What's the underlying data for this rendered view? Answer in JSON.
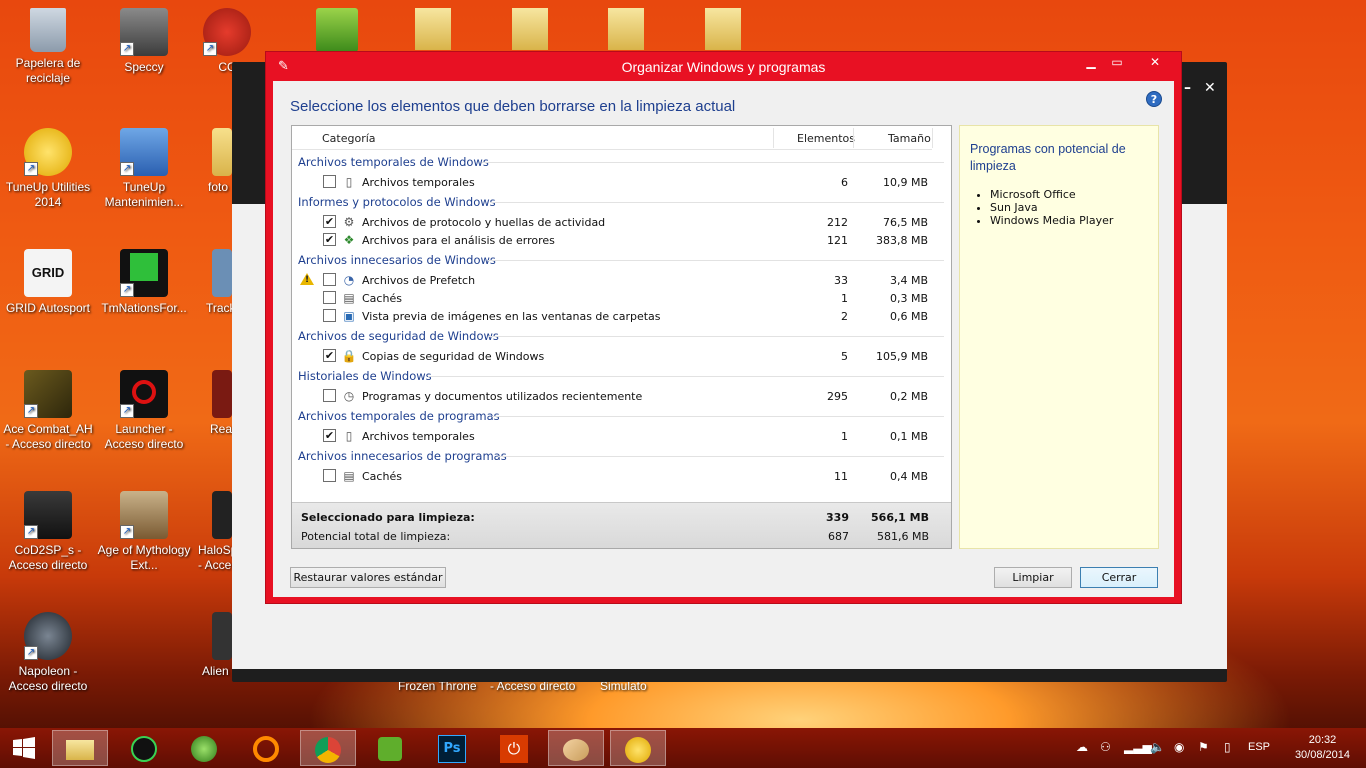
{
  "desktop": {
    "icons": [
      {
        "label": "Papelera de reciclaje",
        "icon": "recycle-bin-icon"
      },
      {
        "label": "Speccy",
        "icon": "speccy-icon"
      },
      {
        "label": "CC",
        "icon": "ccleaner-icon"
      },
      {
        "label": "TuneUp Utilities 2014",
        "icon": "tuneup-icon"
      },
      {
        "label": "TuneUp Mantenimien...",
        "icon": "tuneup-maintenance-icon"
      },
      {
        "label": "foto",
        "icon": "folder-icon"
      },
      {
        "label": "GRID Autosport",
        "icon": "grid-game-icon"
      },
      {
        "label": "TmNationsFor...",
        "icon": "tmnations-icon"
      },
      {
        "label": "Track",
        "icon": "track-icon"
      },
      {
        "label": "Ace Combat_AH - Acceso directo",
        "icon": "ace-combat-icon"
      },
      {
        "label": "Launcher - Acceso directo",
        "icon": "launcher-icon"
      },
      {
        "label": "Rea",
        "icon": "rea-icon"
      },
      {
        "label": "CoD2SP_s - Acceso directo",
        "icon": "cod2-icon"
      },
      {
        "label": "Age of Mythology Ext...",
        "icon": "age-of-mythology-icon"
      },
      {
        "label": "HaloSp - Acce",
        "icon": "halo-icon"
      },
      {
        "label": "Napoleon - Acceso directo",
        "icon": "napoleon-icon"
      },
      {
        "label": "Alien",
        "icon": "alien-icon"
      }
    ],
    "bottom_labels": [
      "Frozen Throne",
      "- Acceso directo",
      "Simulato"
    ]
  },
  "dialog": {
    "title": "Organizar Windows y programas",
    "heading": "Seleccione los elementos que deben borrarse en la limpieza actual",
    "columns": {
      "category": "Categoría",
      "items": "Elementos",
      "size": "Tamaño"
    },
    "groups": [
      {
        "name": "Archivos temporales de Windows",
        "rows": [
          {
            "label": "Archivos temporales",
            "checked": false,
            "count": "6",
            "size": "10,9 MB",
            "icon": "file-icon",
            "warning": false
          }
        ]
      },
      {
        "name": "Informes y protocolos de Windows",
        "rows": [
          {
            "label": "Archivos de protocolo y huellas de actividad",
            "checked": true,
            "count": "212",
            "size": "76,5 MB",
            "icon": "gear-file-icon",
            "warning": false
          },
          {
            "label": "Archivos para el análisis de errores",
            "checked": true,
            "count": "121",
            "size": "383,8 MB",
            "icon": "error-report-icon",
            "warning": false
          }
        ]
      },
      {
        "name": "Archivos innecesarios de Windows",
        "rows": [
          {
            "label": "Archivos de Prefetch",
            "checked": false,
            "count": "33",
            "size": "3,4 MB",
            "icon": "speedometer-icon",
            "warning": true
          },
          {
            "label": "Cachés",
            "checked": false,
            "count": "1",
            "size": "0,3 MB",
            "icon": "cache-icon",
            "warning": false
          },
          {
            "label": "Vista previa de imágenes en las ventanas de carpetas",
            "checked": false,
            "count": "2",
            "size": "0,6 MB",
            "icon": "thumbnail-icon",
            "warning": false
          }
        ]
      },
      {
        "name": "Archivos de seguridad de Windows",
        "rows": [
          {
            "label": "Copias de seguridad de Windows",
            "checked": true,
            "count": "5",
            "size": "105,9 MB",
            "icon": "backup-lock-icon",
            "warning": false
          }
        ]
      },
      {
        "name": "Historiales de Windows",
        "rows": [
          {
            "label": "Programas y documentos utilizados recientemente",
            "checked": false,
            "count": "295",
            "size": "0,2 MB",
            "icon": "history-clock-icon",
            "warning": false
          }
        ]
      },
      {
        "name": "Archivos temporales de programas",
        "rows": [
          {
            "label": "Archivos temporales",
            "checked": true,
            "count": "1",
            "size": "0,1 MB",
            "icon": "file-icon",
            "warning": false
          }
        ]
      },
      {
        "name": "Archivos innecesarios de programas",
        "rows": [
          {
            "label": "Cachés",
            "checked": false,
            "count": "11",
            "size": "0,4 MB",
            "icon": "cache-icon",
            "warning": false
          }
        ]
      }
    ],
    "summary": {
      "selected_label": "Seleccionado para limpieza:",
      "selected_count": "339",
      "selected_size": "566,1 MB",
      "potential_label": "Potencial total de limpieza:",
      "potential_count": "687",
      "potential_size": "581,6 MB"
    },
    "side_panel": {
      "title": "Programas con potencial de limpieza",
      "items": [
        "Microsoft Office",
        "Sun Java",
        "Windows Media Player"
      ]
    },
    "buttons": {
      "restore": "Restaurar valores estándar",
      "clean": "Limpiar",
      "close": "Cerrar"
    }
  },
  "taskbar": {
    "apps": [
      "windows-start-icon",
      "file-explorer-icon",
      "razer-icon",
      "xbox-icon",
      "media-player-icon",
      "chrome-icon",
      "utorrent-icon",
      "photoshop-icon",
      "power-icon",
      "paint-icon",
      "tuneup-taskbar-icon"
    ],
    "language": "ESP",
    "time": "20:32",
    "date": "30/08/2014"
  },
  "colors": {
    "dialog_border": "#e81123",
    "heading_text": "#1e3f8f",
    "side_panel_bg": "#ffffe1"
  }
}
